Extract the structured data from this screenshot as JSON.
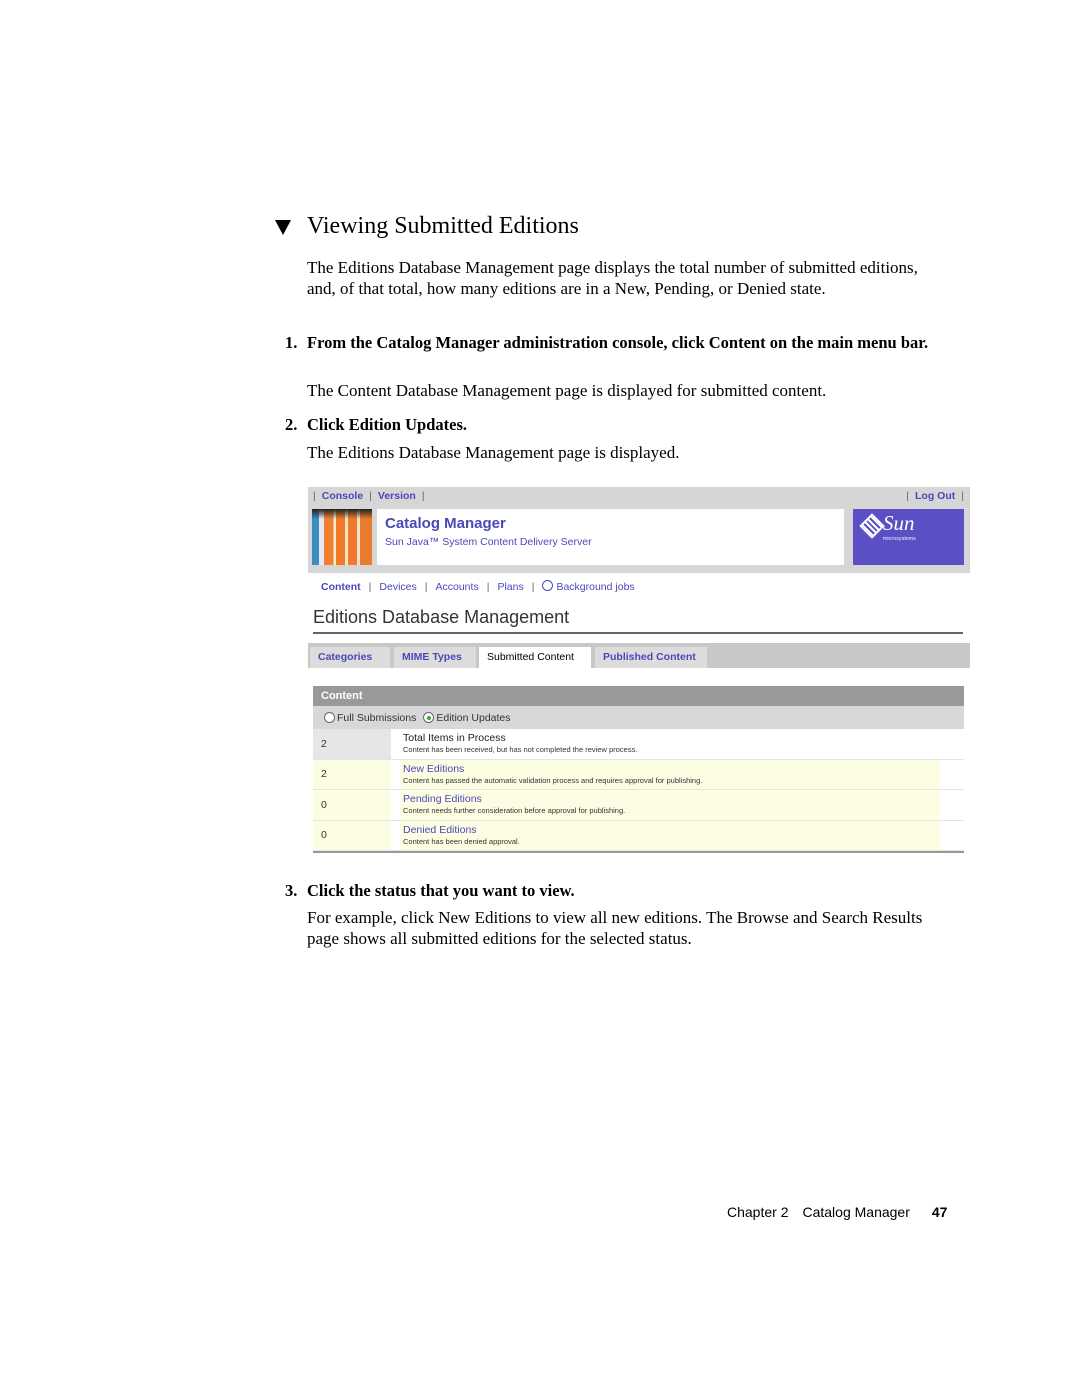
{
  "section": {
    "title": "Viewing Submitted Editions",
    "icon": "triangle-down-icon",
    "intro": "The Editions Database Management page displays the total number of submitted editions, and, of that total, how many editions are in a New, Pending, or Denied state."
  },
  "steps": [
    {
      "number": "1.",
      "instruction": "From the Catalog Manager administration console, click Content on the main menu bar.",
      "result": "The Content Database Management page is displayed for submitted content."
    },
    {
      "number": "2.",
      "instruction": "Click Edition Updates.",
      "result": "The Editions Database Management page is displayed."
    },
    {
      "number": "3.",
      "instruction": "Click the status that you want to view.",
      "result": "For example, click New Editions to view all new editions. The Browse and Search Results page shows all submitted editions for the selected status."
    }
  ],
  "screenshot": {
    "top_links": [
      "Console",
      "Version"
    ],
    "logout_label": "Log Out",
    "app_title": "Catalog Manager",
    "app_subtitle": "Sun Java™ System Content Delivery Server",
    "logo": {
      "word": "Sun",
      "sub": "microsystems"
    },
    "main_nav": [
      {
        "label": "Content",
        "active": true
      },
      {
        "label": "Devices",
        "active": false
      },
      {
        "label": "Accounts",
        "active": false
      },
      {
        "label": "Plans",
        "active": false
      },
      {
        "label": "Background jobs",
        "active": false,
        "icon": "clock-icon"
      }
    ],
    "page_heading": "Editions Database Management",
    "tabs": [
      {
        "label": "Categories",
        "selected": false
      },
      {
        "label": "MIME Types",
        "selected": false
      },
      {
        "label": "Submitted Content",
        "selected": true
      },
      {
        "label": "Published Content",
        "selected": false
      }
    ],
    "content_box": {
      "header": "Content",
      "radio_options": [
        {
          "label": "Full Submissions",
          "checked": false
        },
        {
          "label": "Edition Updates",
          "checked": true
        }
      ],
      "rows": [
        {
          "count": "2",
          "label": "Total Items in Process",
          "description": "Content has been received, but has not completed the review process."
        },
        {
          "count": "2",
          "label": "New Editions",
          "description": "Content has passed the automatic validation process and requires approval for publishing."
        },
        {
          "count": "0",
          "label": "Pending Editions",
          "description": "Content needs further consideration before approval for publishing."
        },
        {
          "count": "0",
          "label": "Denied Editions",
          "description": "Content has been denied approval."
        }
      ]
    },
    "colors": {
      "link": "#4a48b8",
      "sun_logo_bg": "#5a4fc4",
      "row_highlight": "#fdfde4",
      "content_header": "#999999"
    }
  },
  "footer": {
    "chapter": "Chapter 2",
    "chapter_title": "Catalog Manager",
    "page_number": "47"
  }
}
